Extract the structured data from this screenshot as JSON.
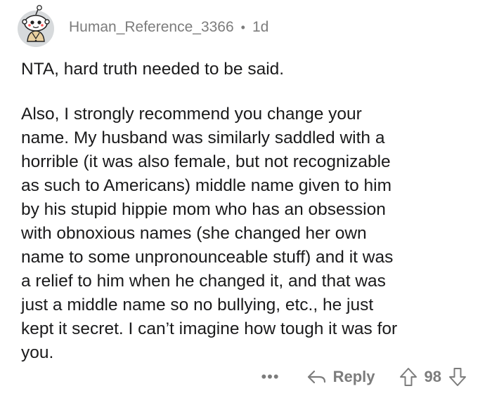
{
  "comment": {
    "username": "Human_Reference_3366",
    "separator": "•",
    "age": "1d",
    "paragraphs": [
      "NTA, hard truth needed to be said.",
      "Also, I strongly recommend you change your\nname. My husband was similarly saddled with a\nhorrible (it was also female, but not recognizable\nas such to Americans) middle name given to him\nby his stupid hippie mom who has an obsession\nwith obnoxious names (she changed her own\nname to some unpronounceable stuff) and it was\na relief to him when he changed it, and that was\njust a middle name so no bullying, etc., he just\nkept it secret. I can’t imagine how tough it was for\nyou."
    ]
  },
  "actions": {
    "more_label": "•••",
    "reply_label": "Reply",
    "score": "98"
  },
  "icons": {
    "avatar": "snoo-avatar-icon",
    "more": "more-options-icon",
    "reply": "reply-arrow-icon",
    "upvote": "upvote-arrow-icon",
    "downvote": "downvote-arrow-icon"
  },
  "colors": {
    "text": "#1a1a1b",
    "meta": "#7c7c7c",
    "avatar_bg": "#d7dadc",
    "background": "#ffffff"
  }
}
